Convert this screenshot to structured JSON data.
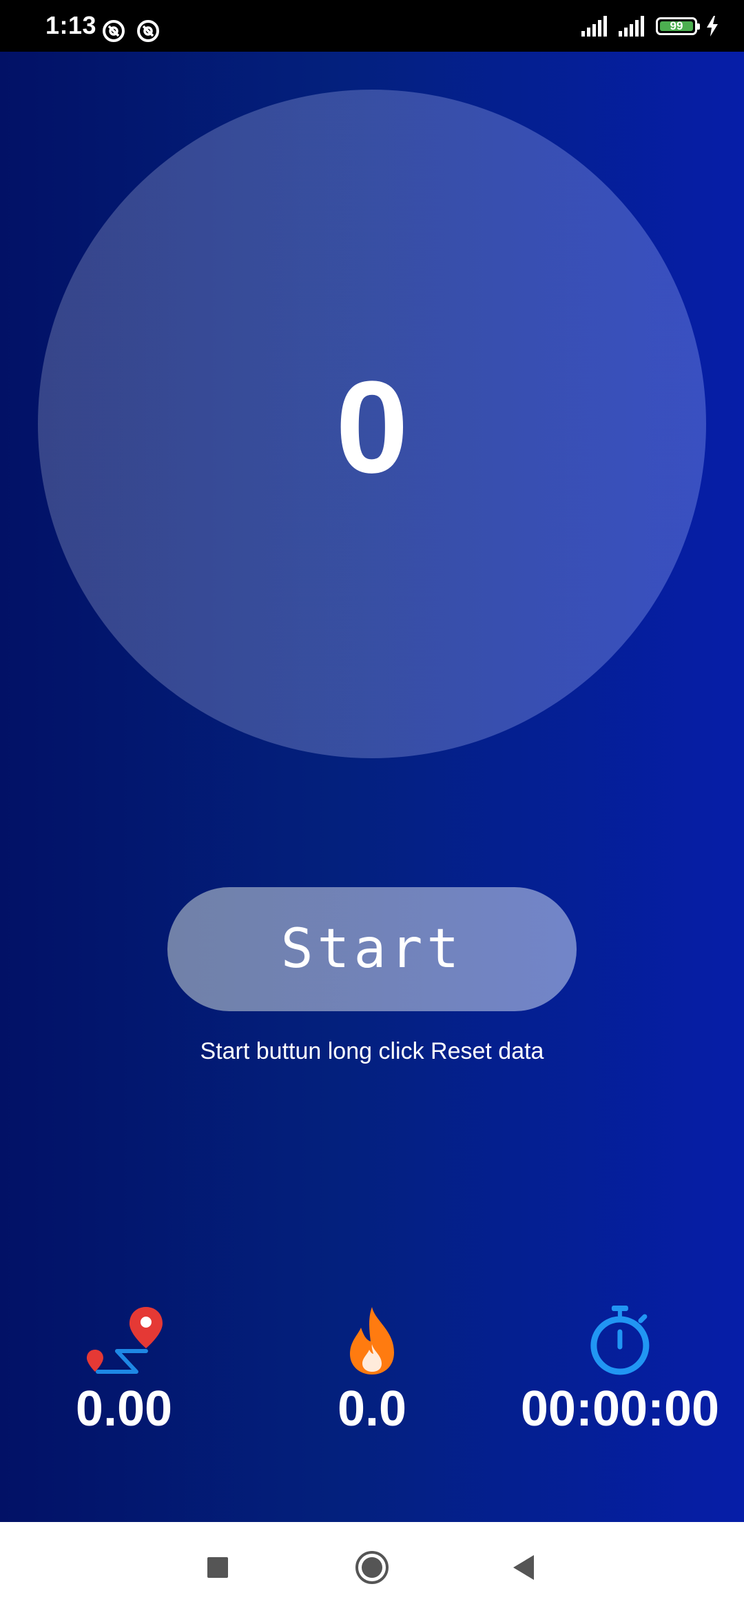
{
  "status_bar": {
    "time": "1:13",
    "battery_level": "99",
    "icons": [
      "at-sign-icon",
      "at-sign-icon",
      "signal-icon",
      "signal-icon",
      "battery-icon",
      "charging-bolt-icon"
    ]
  },
  "counter": {
    "steps": "0"
  },
  "start_button": {
    "label": "Start"
  },
  "hint": {
    "text": "Start buttun long click Reset data"
  },
  "stats": {
    "distance": {
      "icon": "route-pin-icon",
      "value": "0.00"
    },
    "calories": {
      "icon": "flame-icon",
      "value": "0.0"
    },
    "duration": {
      "icon": "stopwatch-icon",
      "value": "00:00:00"
    }
  },
  "nav_bar": {
    "icons": [
      "recent-apps-icon",
      "home-icon",
      "back-icon"
    ]
  },
  "colors": {
    "background_left": "#021166",
    "background_right": "#061ea8",
    "pin_red": "#e53935",
    "route_blue": "#1e88e5",
    "flame_orange": "#ff7b10",
    "stopwatch_blue": "#2196f3",
    "battery_green": "#4caf50"
  }
}
